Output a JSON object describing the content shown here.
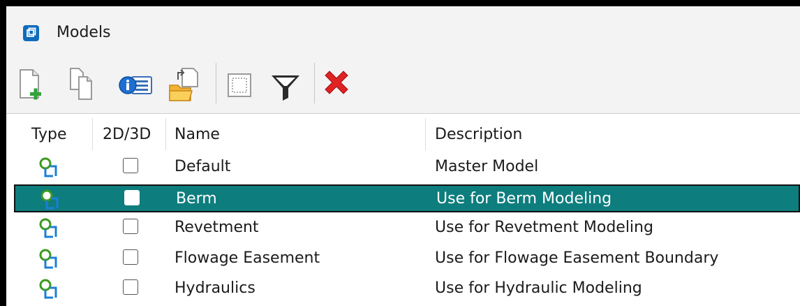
{
  "window": {
    "title": "Models"
  },
  "toolbar": {
    "buttons": [
      {
        "name": "create-model-button",
        "icon": "new-page-plus-icon"
      },
      {
        "name": "copy-model-button",
        "icon": "copy-pages-icon"
      },
      {
        "name": "properties-button",
        "icon": "info-list-icon"
      },
      {
        "name": "import-button",
        "icon": "folder-import-icon"
      },
      {
        "name": "select-button",
        "icon": "selection-rect-icon"
      },
      {
        "name": "filter-button",
        "icon": "funnel-icon"
      },
      {
        "name": "delete-button",
        "icon": "red-x-icon"
      }
    ]
  },
  "table": {
    "columns": [
      "Type",
      "2D/3D",
      "Name",
      "Description"
    ],
    "rows": [
      {
        "name": "Default",
        "description": "Master Model",
        "checked": false,
        "selected": false
      },
      {
        "name": "Berm",
        "description": "Use for Berm Modeling",
        "checked": false,
        "selected": true
      },
      {
        "name": "Revetment",
        "description": "Use for Revetment Modeling",
        "checked": false,
        "selected": false
      },
      {
        "name": "Flowage Easement",
        "description": "Use for Flowage Easement Boundary",
        "checked": false,
        "selected": false
      },
      {
        "name": "Hydraulics",
        "description": "Use for Hydraulic Modeling",
        "checked": false,
        "selected": false
      }
    ]
  },
  "colors": {
    "selection": "#0e7d7d",
    "accent": "#0f6cbd",
    "type_icon_green": "#3a9a1e",
    "type_icon_blue": "#1c7fd6"
  }
}
